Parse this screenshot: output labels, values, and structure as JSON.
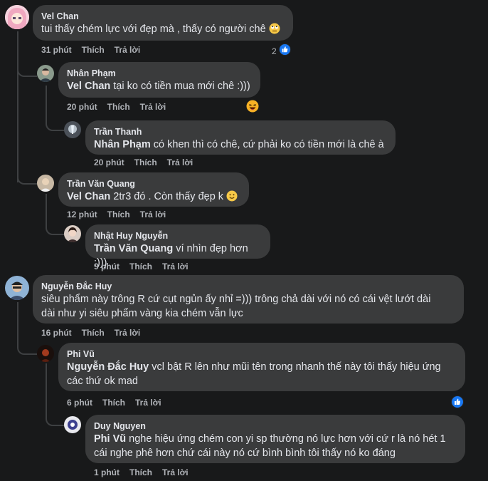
{
  "comments": [
    {
      "author": "Vel Chan",
      "text": "tui thấy chém lực với đẹp mà , thấy có người chê",
      "emoji": "rolling-eyes",
      "time": "31 phút",
      "like": "Thích",
      "reply": "Trả lời",
      "reaction_count": "2"
    },
    {
      "author": "Nhân Phạm",
      "mention": "Vel Chan",
      "text": " tại ko có tiền mua mới chê :)))",
      "time": "20 phút",
      "like": "Thích",
      "reply": "Trả lời",
      "reaction": "haha"
    },
    {
      "author": "Trần Thanh",
      "mention": "Nhân Phạm",
      "text": " có khen thì có chê, cứ phải ko có tiền mới là chê à",
      "time": "20 phút",
      "like": "Thích",
      "reply": "Trả lời"
    },
    {
      "author": "Trần Văn Quang",
      "mention": "Vel Chan",
      "text": " 2tr3 đó . Còn thấy đẹp k",
      "emoji": "slight-smile",
      "time": "12 phút",
      "like": "Thích",
      "reply": "Trả lời"
    },
    {
      "author": "Nhật Huy Nguyễn",
      "mention": "Trần Văn Quang",
      "text": " ví nhìn đẹp hơn :)))",
      "time": "9 phút",
      "like": "Thích",
      "reply": "Trả lời"
    },
    {
      "author": "Nguyễn Đắc Huy",
      "text_line1": "siêu phẩm này trông R cứ cụt ngủn ấy nhỉ =))) trông chả dài với nó có cái vệt lướt dài",
      "text_line2": "dài như yi siêu phẩm vàng kia chém vẫn lực",
      "time": "16 phút",
      "like": "Thích",
      "reply": "Trả lời"
    },
    {
      "author": "Phi Vũ",
      "mention": "Nguyễn Đắc Huy",
      "text_line1": " vcl bật R lên như mũi tên trong nhanh thế này tôi thấy hiệu ứng",
      "text_line2": "các thứ ok mad",
      "time": "6 phút",
      "like": "Thích",
      "reply": "Trả lời",
      "reaction": "like"
    },
    {
      "author": "Duy Nguyen",
      "mention": "Phi Vũ",
      "text_line1": " nghe hiệu ứng chém con yi sp thường nó lực hơn với cứ r là nó hét 1",
      "text_line2": "cái nghe phê hơn chứ cái này nó cứ bình bình tôi thấy nó ko đáng",
      "time": "1 phút",
      "like": "Thích",
      "reply": "Trả lời"
    }
  ],
  "colors": {
    "bubble": "#3a3b3c",
    "background": "#18191a",
    "like_blue": "#1877f2"
  }
}
